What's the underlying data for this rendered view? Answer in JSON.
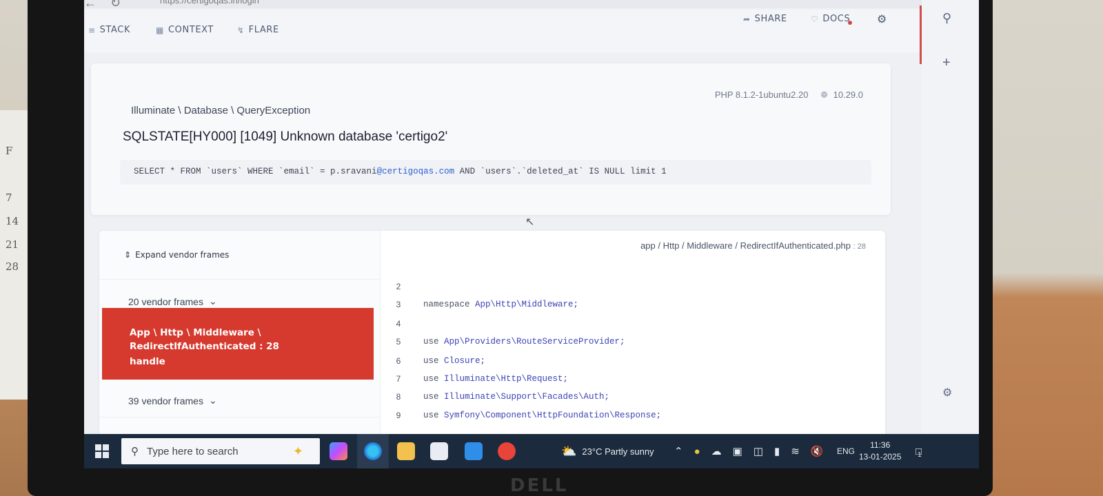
{
  "browser": {
    "url": "https://certigoqas.in/login"
  },
  "topnav": {
    "left": [
      {
        "label": "STACK",
        "icon": "stack-icon"
      },
      {
        "label": "CONTEXT",
        "icon": "context-icon"
      },
      {
        "label": "FLARE",
        "icon": "flare-icon"
      }
    ],
    "right": [
      {
        "label": "SHARE",
        "icon": "share-icon"
      },
      {
        "label": "DOCS",
        "icon": "docs-icon"
      }
    ],
    "settings_icon": "gear-icon"
  },
  "sidebar_right": {
    "search_icon": "search-icon",
    "add_icon": "plus-icon",
    "settings_icon": "gear-icon"
  },
  "error": {
    "exception_class": "Illuminate \\ Database \\ QueryException",
    "php_version": "PHP 8.1.2-1ubuntu2.20",
    "laravel_version": "10.29.0",
    "message": "SQLSTATE[HY000] [1049] Unknown database 'certigo2'",
    "sql": {
      "part1": "SELECT * FROM `users` WHERE `email` = p.sravani",
      "link": "@certigoqas.com",
      "part2": " AND `users`.`deleted_at` IS NULL limit 1"
    }
  },
  "stack": {
    "expand_label": "Expand vendor frames",
    "vendor_frames_top": "20 vendor frames",
    "active_frame": {
      "line1": "App \\ Http \\ Middleware \\",
      "line2": "RedirectIfAuthenticated : 28",
      "line3": "handle"
    },
    "vendor_frames_bottom": "39 vendor frames",
    "file_path": "app / Http / Middleware / RedirectIfAuthenticated.php",
    "file_line": ": 28",
    "code": [
      {
        "num": "2",
        "kw": "",
        "ns": ""
      },
      {
        "num": "3",
        "kw": "namespace ",
        "ns": "App\\Http\\Middleware;"
      },
      {
        "num": "4",
        "kw": "",
        "ns": ""
      },
      {
        "num": "5",
        "kw": "use ",
        "ns": "App\\Providers\\RouteServiceProvider;"
      },
      {
        "num": "6",
        "kw": "use ",
        "ns": "Closure;"
      },
      {
        "num": "7",
        "kw": "use ",
        "ns": "Illuminate\\Http\\Request;"
      },
      {
        "num": "8",
        "kw": "use ",
        "ns": "Illuminate\\Support\\Facades\\Auth;"
      },
      {
        "num": "9",
        "kw": "use ",
        "ns": "Symfony\\Component\\HttpFoundation\\Response;"
      }
    ]
  },
  "taskbar": {
    "search_placeholder": "Type here to search",
    "weather": "23°C  Partly sunny",
    "language": "ENG",
    "time": "11:36",
    "date": "13-01-2025",
    "notification_count": "1"
  },
  "surroundings": {
    "calendar_letter": "F",
    "calendar_days": [
      "7",
      "14",
      "21",
      "28"
    ],
    "laptop_brand": "DELL"
  }
}
